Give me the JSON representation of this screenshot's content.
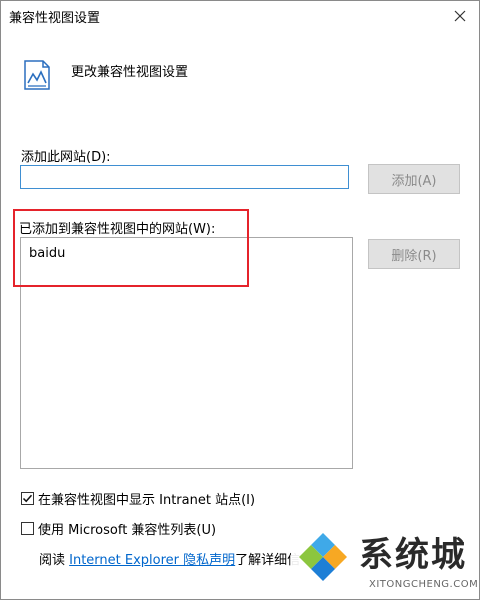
{
  "window": {
    "title": "兼容性视图设置",
    "close_symbol": "✕"
  },
  "header": {
    "icon": "compat-view-settings-icon",
    "text": "更改兼容性视图设置"
  },
  "add_site": {
    "label": "添加此网站(D):",
    "input_value": "",
    "button_label": "添加(A)"
  },
  "site_list": {
    "label": "已添加到兼容性视图中的网站(W):",
    "items": [
      "baidu"
    ],
    "remove_label": "删除(R)"
  },
  "options": {
    "intranet": {
      "label": "在兼容性视图中显示 Intranet 站点(I)",
      "checked": true
    },
    "ms_list": {
      "label": "使用 Microsoft 兼容性列表(U)",
      "checked": false
    }
  },
  "footer": {
    "read_prefix": "阅读 ",
    "link_text": "Internet Explorer 隐私声明",
    "read_suffix": "了解详细信"
  },
  "watermark": {
    "name": "系统城",
    "url": "XITONGCHENG.COM"
  },
  "colors": {
    "highlight": "#e5232b",
    "link": "#0066cc",
    "input_border": "#3f8fd2"
  }
}
